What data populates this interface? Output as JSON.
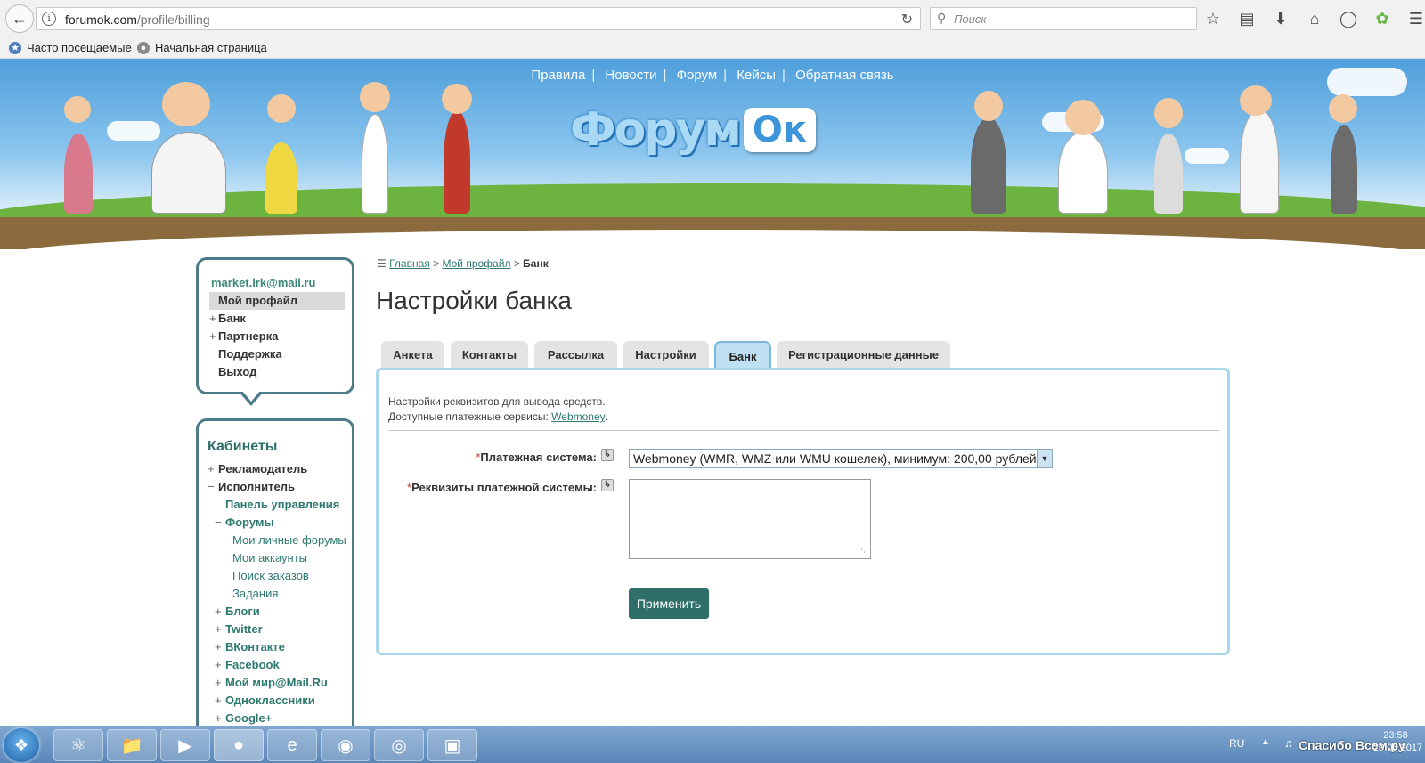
{
  "browser": {
    "url_domain": "forumok.com",
    "url_path": "/profile/billing",
    "search_placeholder": "Поиск",
    "bookmarks": [
      "Часто посещаемые",
      "Начальная страница"
    ]
  },
  "site": {
    "top_menu": [
      "Правила",
      "Новости",
      "Форум",
      "Кейсы",
      "Обратная связь"
    ],
    "logo_main": "Форум",
    "logo_ok": "Ок"
  },
  "profile": {
    "email": "market.irk@mail.ru",
    "menu": [
      {
        "label": "Мой профайл",
        "prefix": "",
        "active": true
      },
      {
        "label": "Банк",
        "prefix": "+",
        "active": false
      },
      {
        "label": "Партнерка",
        "prefix": "+",
        "active": false
      },
      {
        "label": "Поддержка",
        "prefix": "",
        "active": false
      },
      {
        "label": "Выход",
        "prefix": "",
        "active": false
      }
    ]
  },
  "cabinets": {
    "title": "Кабинеты",
    "items": [
      {
        "label": "Рекламодатель",
        "prefix": "+",
        "level": 0
      },
      {
        "label": "Исполнитель",
        "prefix": "−",
        "level": 0
      },
      {
        "label": "Панель управления",
        "prefix": "",
        "level": 1
      },
      {
        "label": "Форумы",
        "prefix": "−",
        "level": 1
      },
      {
        "label": "Мои личные форумы",
        "prefix": "",
        "level": 2
      },
      {
        "label": "Мои аккаунты",
        "prefix": "",
        "level": 2
      },
      {
        "label": "Поиск заказов",
        "prefix": "",
        "level": 2
      },
      {
        "label": "Задания",
        "prefix": "",
        "level": 2
      },
      {
        "label": "Блоги",
        "prefix": "+",
        "level": 1
      },
      {
        "label": "Twitter",
        "prefix": "+",
        "level": 1
      },
      {
        "label": "ВКонтакте",
        "prefix": "+",
        "level": 1
      },
      {
        "label": "Facebook",
        "prefix": "+",
        "level": 1
      },
      {
        "label": "Мой мир@Mail.Ru",
        "prefix": "+",
        "level": 1
      },
      {
        "label": "Одноклассники",
        "prefix": "+",
        "level": 1
      },
      {
        "label": "Google+",
        "prefix": "+",
        "level": 1
      }
    ]
  },
  "breadcrumb": {
    "home": "Главная",
    "sep": ">",
    "profile": "Мой профайл",
    "current": "Банк"
  },
  "page_title": "Настройки банка",
  "tabs": [
    {
      "label": "Анкета",
      "active": false
    },
    {
      "label": "Контакты",
      "active": false
    },
    {
      "label": "Рассылка",
      "active": false
    },
    {
      "label": "Настройки",
      "active": false
    },
    {
      "label": "Банк",
      "active": true
    },
    {
      "label": "Регистрационные данные",
      "active": false
    }
  ],
  "form": {
    "intro_line1": "Настройки реквизитов для вывода средств.",
    "intro_line2": "Доступные платежные сервисы:",
    "intro_link": "Webmoney",
    "intro_dot": ".",
    "payment_label": "Платежная система:",
    "payment_value": "Webmoney (WMR, WMZ или WMU кошелек), минимум: 200,00  рублей",
    "details_label": "Реквизиты платежной системы:",
    "details_value": "",
    "required_mark": "*",
    "apply_button": "Применить"
  },
  "taskbar": {
    "lang": "RU",
    "thanks_text": "Спасибо Всем.ру",
    "time": "23:58",
    "date": "29.06.2017"
  },
  "colors": {
    "accent": "#2f6f6a",
    "link": "#2e7a70",
    "sidebar_border": "#4d7b8a",
    "content_border": "#a9d6ec"
  }
}
